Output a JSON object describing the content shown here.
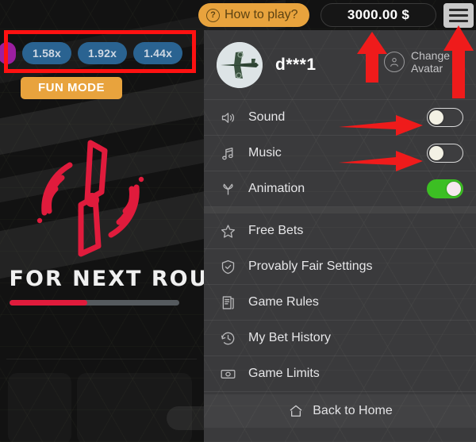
{
  "top_bar": {
    "how_to_play": {
      "label": "How to play?",
      "icon": "question-circle-icon",
      "bg": "#e8a33d"
    },
    "balance": {
      "value": "3000.00 $"
    },
    "menu_button": {
      "icon": "hamburger-menu-icon"
    }
  },
  "game": {
    "multipliers": [
      {
        "value": "1.58x",
        "color": "#2a6391"
      },
      {
        "value": "1.92x",
        "color": "#2a6391"
      },
      {
        "value": "1.44x",
        "color": "#2a6391"
      }
    ],
    "partial_multiplier_color": "#9c1fa0",
    "fun_mode_label": "FUN MODE",
    "status_text": "G FOR NEXT ROUN",
    "progress_percent": 46,
    "progress_fill_color": "#e01b3c",
    "propeller_color": "#e01b3c"
  },
  "menu": {
    "profile": {
      "username": "d***1",
      "avatar_icon": "airplane-avatar",
      "change_avatar_label": "Change Avatar",
      "change_avatar_icon": "person-circle-icon"
    },
    "items": [
      {
        "label": "Sound",
        "icon": "speaker-icon",
        "toggle": "off"
      },
      {
        "label": "Music",
        "icon": "music-note-icon",
        "toggle": "off"
      },
      {
        "label": "Animation",
        "icon": "propeller-icon",
        "toggle": "on"
      },
      {
        "label": "Free Bets",
        "icon": "star-icon"
      },
      {
        "label": "Provably Fair Settings",
        "icon": "shield-check-icon"
      },
      {
        "label": "Game Rules",
        "icon": "document-icon"
      },
      {
        "label": "My Bet History",
        "icon": "clock-history-icon"
      },
      {
        "label": "Game Limits",
        "icon": "banknote-icon"
      }
    ],
    "footer": {
      "label": "Back to Home",
      "icon": "home-icon"
    },
    "toggle_on_color": "#3cbf23"
  },
  "annotations": {
    "highlight_color": "#ff1111",
    "arrows": [
      {
        "name": "arrow-to-balance",
        "direction": "up"
      },
      {
        "name": "arrow-to-menu-button",
        "direction": "up"
      },
      {
        "name": "arrow-to-sound-toggle",
        "direction": "right"
      },
      {
        "name": "arrow-to-music-toggle",
        "direction": "right"
      }
    ],
    "rect": {
      "name": "multiplier-history-highlight"
    }
  }
}
